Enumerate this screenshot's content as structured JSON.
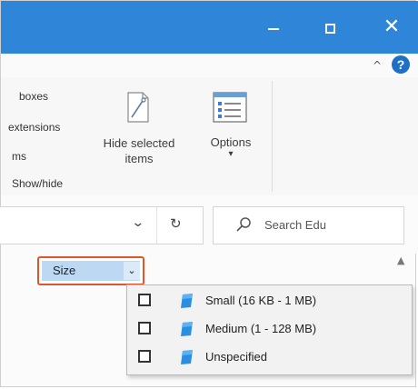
{
  "window": {
    "minimize_glyph": "",
    "maximize_glyph": "",
    "close_glyph": "✕"
  },
  "ribbon_header": {
    "collapse_glyph": "^",
    "help_glyph": "?"
  },
  "ribbon": {
    "partial_labels": [
      "boxes",
      "extensions",
      "ms"
    ],
    "group_label": "Show/hide",
    "hide_selected_line1": "Hide selected",
    "hide_selected_line2": "items",
    "options_label": "Options",
    "options_arrow": "▾"
  },
  "address_bar": {
    "chevron_glyph": "⌄",
    "refresh_glyph": "↻"
  },
  "search": {
    "placeholder": "Search Edu",
    "icon": "search-icon"
  },
  "filter": {
    "label": "Size",
    "chevron": "⌄"
  },
  "scroll": {
    "up_glyph": "▲"
  },
  "size_menu": {
    "items": [
      {
        "label": "Small (16 KB - 1 MB)",
        "checked": false,
        "icon": "blue-tile-icon"
      },
      {
        "label": "Medium (1 - 128 MB)",
        "checked": false,
        "icon": "blue-tile-icon"
      },
      {
        "label": "Unspecified",
        "checked": false,
        "icon": "blue-tile-icon"
      }
    ]
  },
  "colors": {
    "titlebar": "#2f86d8",
    "highlight_border": "#e2552a",
    "selected_fill": "#bcd8f2",
    "tile_blue": "#2a8fe0"
  }
}
